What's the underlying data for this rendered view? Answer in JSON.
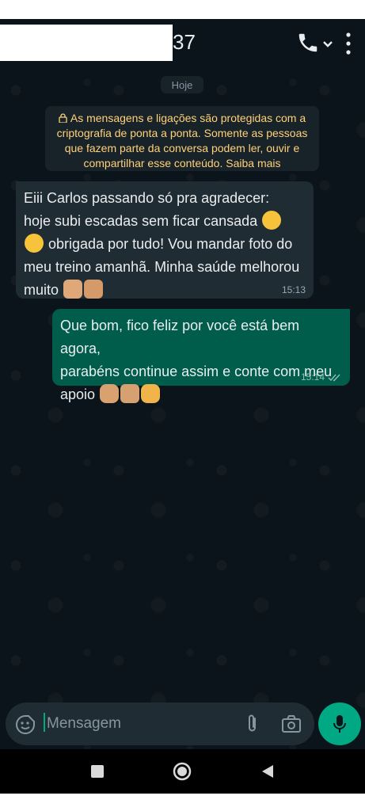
{
  "header": {
    "title": "37"
  },
  "chat": {
    "day_label": "Hoje",
    "encryption_notice": "As mensagens e ligações são protegidas com a criptografia de ponta a ponta. Somente as pessoas que fazem parte da conversa podem ler, ouvir e compartilhar esse conteúdo. Saiba mais",
    "messages": [
      {
        "direction": "incoming",
        "lines": [
          "Eiii Carlos passando só pra agradecer:",
          "hoje subi escadas sem ficar cansada",
          "obrigada por tudo! Vou mandar foto do",
          "meu treino amanhã. Minha saúde melhorou",
          "muito"
        ],
        "time": "15:13"
      },
      {
        "direction": "outgoing",
        "lines": [
          "Que bom, fico feliz por você está bem agora,",
          "parabéns continue assim e conte com meu",
          "apoio"
        ],
        "time": "15:14",
        "status": "read"
      }
    ]
  },
  "composer": {
    "placeholder": "Mensagem"
  },
  "colors": {
    "background": "#0b141a",
    "incoming_bubble": "#202c33",
    "outgoing_bubble": "#005c4b",
    "accent": "#00a884",
    "notice_text": "#ffd279"
  },
  "icons": {
    "call": "phone-icon",
    "menu": "more-vertical-icon",
    "sticker": "sticker-icon",
    "attach": "paperclip-icon",
    "camera": "camera-icon",
    "mic": "microphone-icon"
  }
}
